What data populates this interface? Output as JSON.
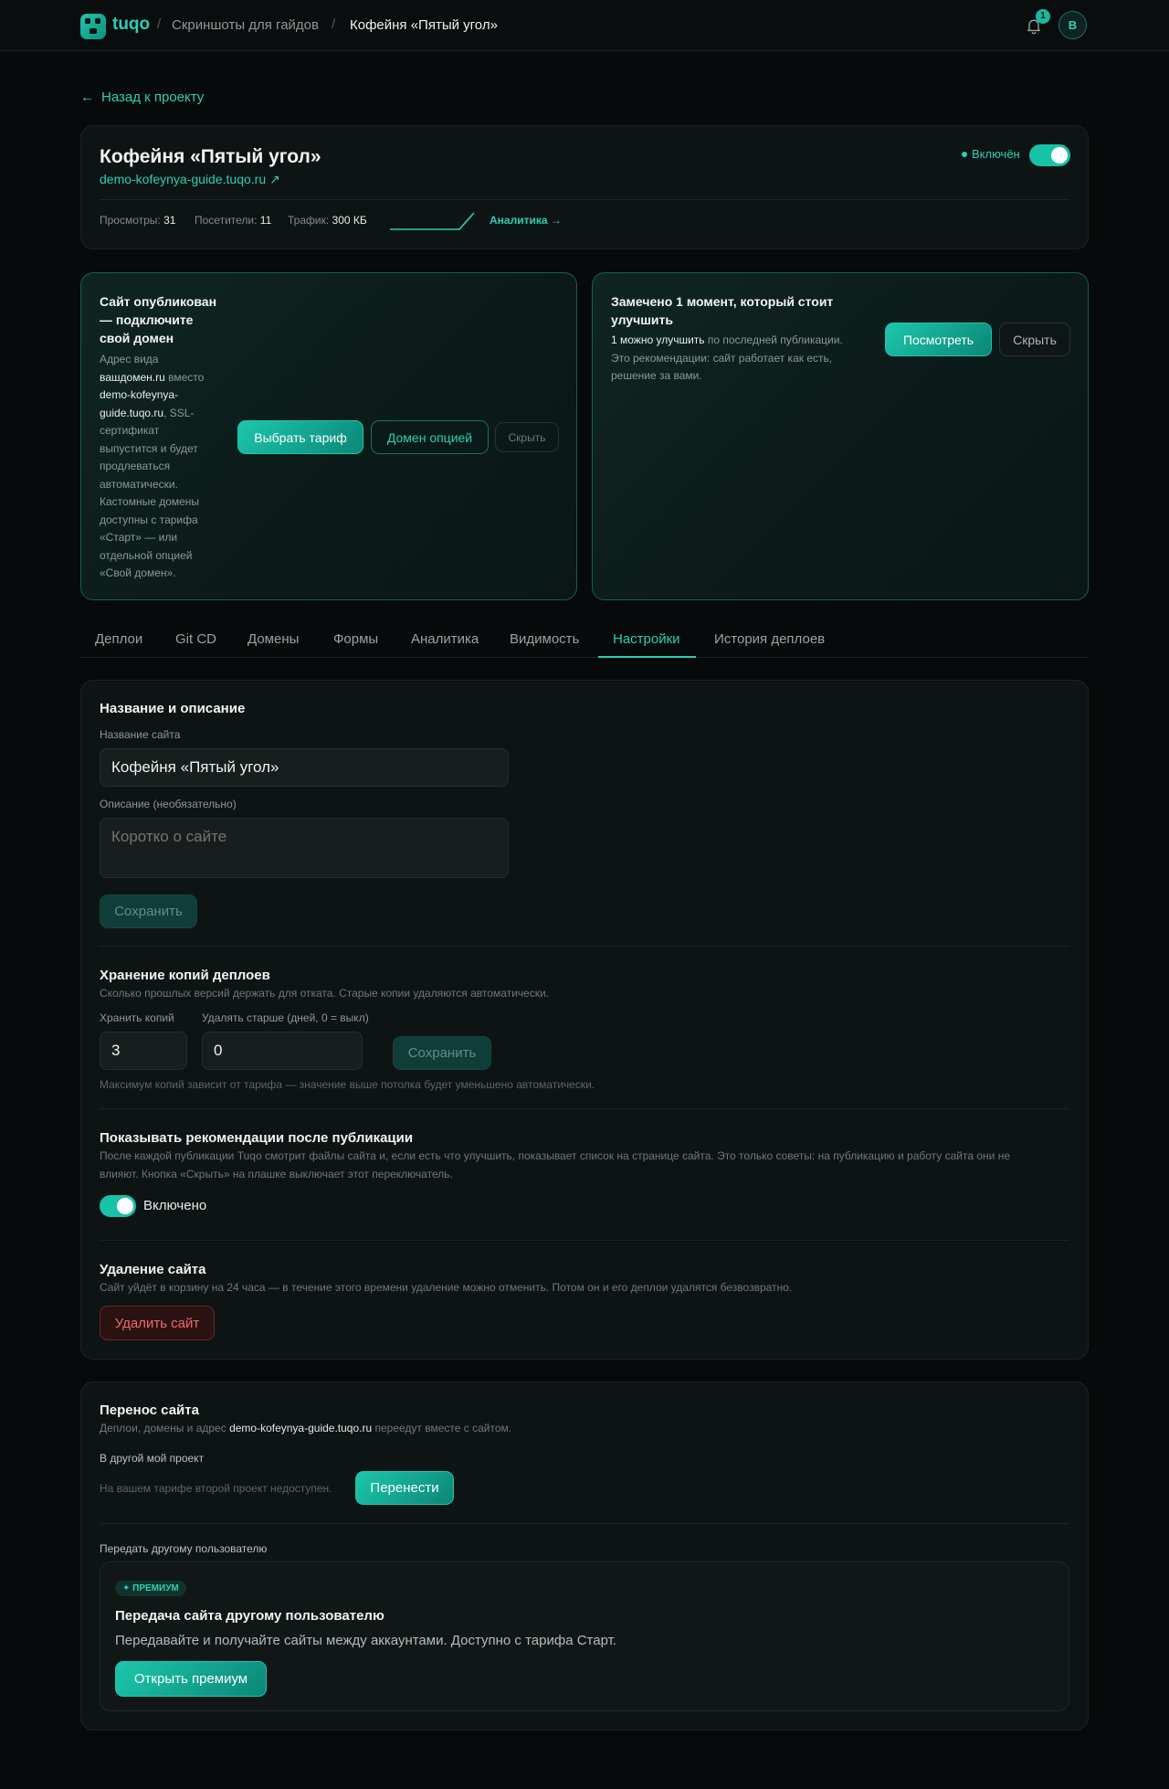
{
  "header": {
    "logo_text": "tuqo",
    "breadcrumbs": [
      "Скриншоты для гайдов",
      "Кофейня «Пятый угол»"
    ],
    "notification_count": "1",
    "avatar_letter": "В"
  },
  "back_link": "Назад к проекту",
  "site": {
    "title": "Кофейня «Пятый угол»",
    "url": "demo-kofeynya-guide.tuqo.ru ↗",
    "status": "Включён",
    "enabled": true,
    "stats": {
      "views_label": "Просмотры:",
      "views": "31",
      "visitors_label": "Посетители:",
      "visitors": "11",
      "traffic_label": "Трафик:",
      "traffic": "300 КБ"
    },
    "analytics_link": "Аналитика →"
  },
  "domain_promo": {
    "title_lines": [
      "Сайт опубликован",
      "— подключите",
      "свой домен"
    ],
    "text_lines": [
      [
        {
          "t": "Адрес вида"
        }
      ],
      [
        {
          "t": "вашдомен.ru",
          "b": true
        },
        {
          "t": " вместо"
        }
      ],
      [
        {
          "t": "demo-kofeynya-",
          "b": true
        }
      ],
      [
        {
          "t": "guide.tuqo.ru",
          "b": true
        },
        {
          "t": ", SSL-"
        }
      ],
      [
        {
          "t": "сертификат"
        }
      ],
      [
        {
          "t": "выпустится и будет"
        }
      ],
      [
        {
          "t": "продлеваться"
        }
      ],
      [
        {
          "t": "автоматически."
        }
      ],
      [
        {
          "t": "Кастомные домены"
        }
      ],
      [
        {
          "t": "доступны с тарифа"
        }
      ],
      [
        {
          "t": "«Старт» — или"
        }
      ],
      [
        {
          "t": "отдельной опцией"
        }
      ],
      [
        {
          "t": "«Свой домен»."
        }
      ]
    ],
    "choose_plan": "Выбрать тариф",
    "domain_option": "Домен опцией",
    "hide": "Скрыть"
  },
  "recs_promo": {
    "title_lines": [
      "Замечено 1 момент, который стоит",
      "улучшить"
    ],
    "text_lines": [
      [
        {
          "t": "1 можно улучшить",
          "b": true
        },
        {
          "t": " по последней публикации."
        }
      ],
      [
        {
          "t": "Это рекомендации: сайт работает как есть,"
        }
      ],
      [
        {
          "t": "решение за вами."
        }
      ]
    ],
    "view": "Посмотреть",
    "hide": "Скрыть"
  },
  "tabs": [
    "Деплои",
    "Git CD",
    "Домены",
    "Формы",
    "Аналитика",
    "Видимость",
    "Настройки",
    "История деплоев"
  ],
  "active_tab": "Настройки",
  "settings": {
    "name_section": {
      "title": "Название и описание",
      "name_label": "Название сайта",
      "name_value": "Кофейня «Пятый угол»",
      "desc_label": "Описание (необязательно)",
      "desc_placeholder": "Коротко о сайте",
      "save": "Сохранить"
    },
    "backups": {
      "title": "Хранение копий деплоев",
      "subtitle": "Сколько прошлых версий держать для отката. Старые копии удаляются автоматически.",
      "keep_label": "Хранить копий",
      "keep_value": "3",
      "delete_label": "Удалять старше (дней, 0 = выкл)",
      "delete_value": "0",
      "save": "Сохранить",
      "note": "Максимум копий зависит от тарифа — значение выше потолка будет уменьшено автоматически."
    },
    "recommendations": {
      "title": "Показывать рекомендации после публикации",
      "text_line1": "После каждой публикации Tuqo смотрит файлы сайта и, если есть что улучшить, показывает список на странице сайта. Это только советы: на публикацию и работу сайта они не",
      "text_line2": "влияют. Кнопка «Скрыть» на плашке выключает этот переключатель.",
      "toggle_label": "Включено",
      "enabled": true
    },
    "delete": {
      "title": "Удаление сайта",
      "text": "Сайт уйдёт в корзину на 24 часа — в течение этого времени удаление можно отменить. Потом он и его деплои удалятся безвозвратно.",
      "button": "Удалить сайт"
    }
  },
  "transfer": {
    "title": "Перенос сайта",
    "subtitle_pre": "Деплои, домены и адрес ",
    "subtitle_addr": "demo-kofeynya-guide.tuqo.ru",
    "subtitle_post": " переедут вместе с сайтом.",
    "own_project_label": "В другой мой проект",
    "own_project_note": "На вашем тарифе второй проект недоступен.",
    "move_button": "Перенести",
    "other_user_label": "Передать другому пользователю",
    "premium": {
      "badge": "✦ ПРЕМИУМ",
      "title": "Передача сайта другому пользователю",
      "text": "Передавайте и получайте сайты между аккаунтами. Доступно с тарифа Старт.",
      "button": "Открыть премиум"
    }
  },
  "colors": {
    "accent": "#2ccfb4",
    "background": "#070a0a",
    "card": "#0e1414",
    "danger": "#ef6b6b"
  }
}
